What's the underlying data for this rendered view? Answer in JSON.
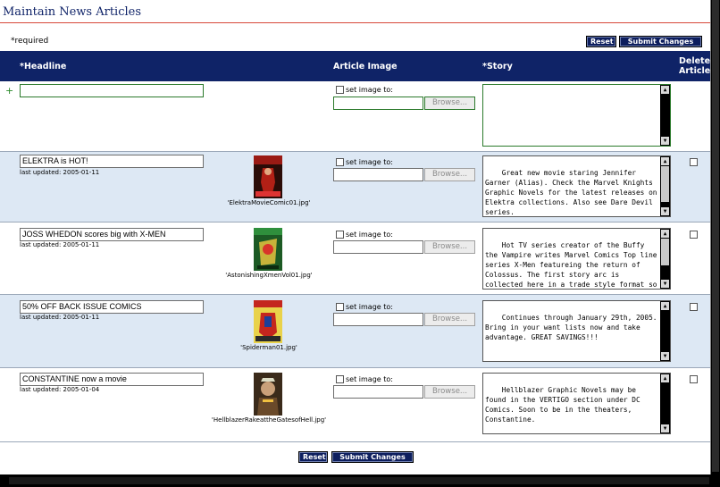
{
  "page": {
    "title": "Maintain News Articles",
    "required_note": "*required",
    "reset_label": "Reset",
    "submit_label": "Submit Changes"
  },
  "columns": {
    "headline": "*Headline",
    "image": "Article Image",
    "story": "*Story",
    "delete_line1": "Delete",
    "delete_line2": "Article"
  },
  "new_article": {
    "add_symbol": "+",
    "headline": "",
    "set_image_label": "set image to:",
    "browse_label": "Browse...",
    "story": ""
  },
  "articles": [
    {
      "headline": "ELEKTRA is HOT!",
      "last_updated": "last updated: 2005-01-11",
      "image_file": "'ElektraMovieComic01.jpg'",
      "set_image_label": "set image to:",
      "browse_label": "Browse...",
      "story": "Great new movie staring Jennifer Garner (Alias). Check the Marvel Knights Graphic Novels for the latest releases on Elektra collections. Also see Dare Devil series."
    },
    {
      "headline": "JOSS WHEDON scores big with X-MEN",
      "last_updated": "last updated: 2005-01-11",
      "image_file": "'AstonishingXmenVol01.jpg'",
      "set_image_label": "set image to:",
      "browse_label": "Browse...",
      "story": "Hot TV series creator of the Buffy the Vampire writes Marvel Comics Top line series X-Men featureing the return of Colossus. The first story arc is collected here in a trade style format so the story"
    },
    {
      "headline": "50% OFF BACK ISSUE COMICS",
      "last_updated": "last updated: 2005-01-11",
      "image_file": "'Spiderman01.jpg'",
      "set_image_label": "set image to:",
      "browse_label": "Browse...",
      "story": "Continues through January 29th, 2005. Bring in your want lists now and take advantage. GREAT SAVINGS!!!"
    },
    {
      "headline": "CONSTANTINE now a movie",
      "last_updated": "last updated: 2005-01-04",
      "image_file": "'HellblazerRakeattheGatesofHell.jpg'",
      "set_image_label": "set image to:",
      "browse_label": "Browse...",
      "story": "Hellblazer Graphic Novels may be found in the VERTIGO section under DC Comics. Soon to be in the theaters, Constantine."
    }
  ],
  "colors": {
    "header_bg": "#0f2367",
    "row_alt_bg": "#dde8f4",
    "title_rule": "#d8483a",
    "button_bg": "#0d1e5e",
    "new_row_border": "#2b7a2b"
  },
  "icons": {
    "add": "plus-icon",
    "scroll_up": "up-arrow-icon",
    "scroll_down": "down-arrow-icon"
  }
}
